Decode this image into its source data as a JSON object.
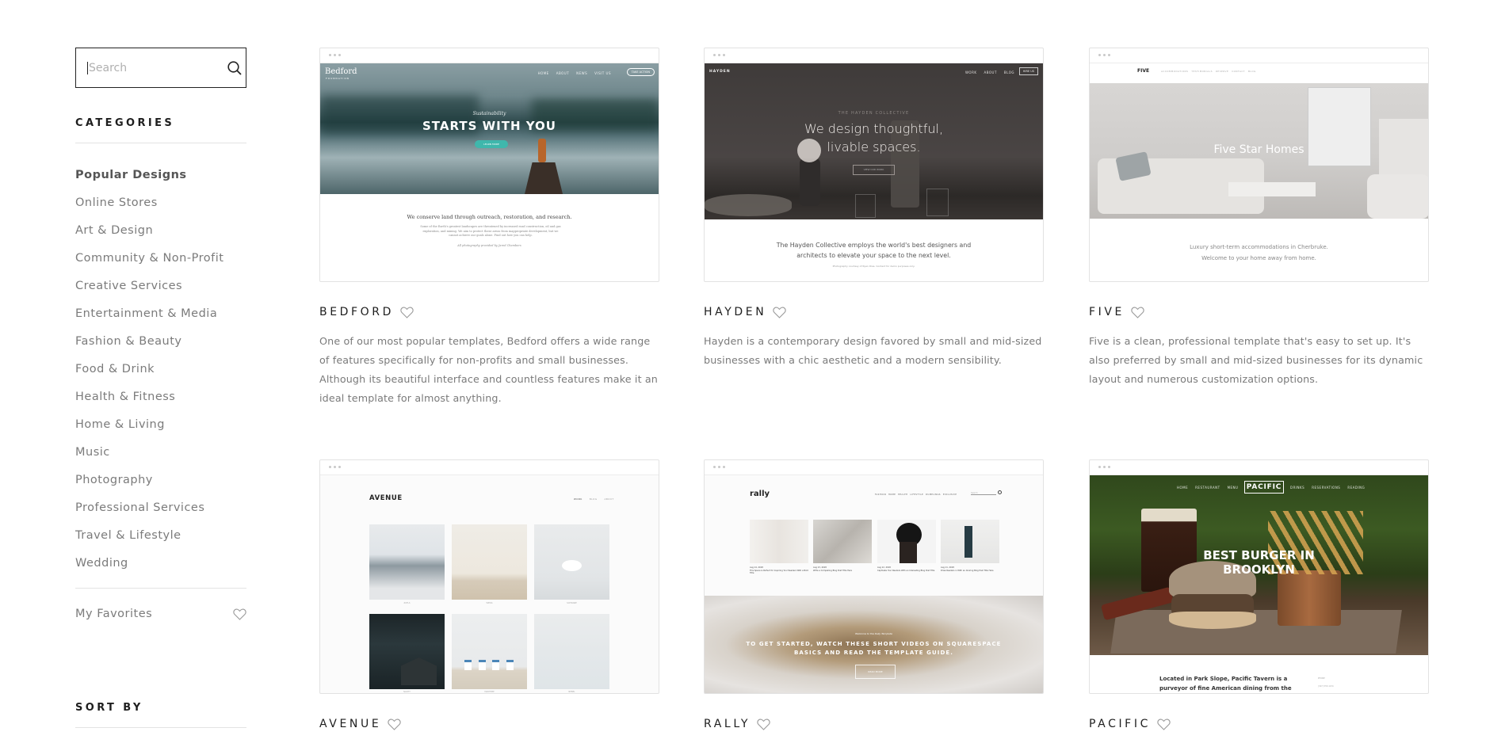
{
  "search": {
    "placeholder": "Search"
  },
  "sidebar": {
    "categories_title": "CATEGORIES",
    "categories": [
      {
        "label": "Popular Designs",
        "active": true
      },
      {
        "label": "Online Stores"
      },
      {
        "label": "Art & Design"
      },
      {
        "label": "Community & Non-Profit"
      },
      {
        "label": "Creative Services"
      },
      {
        "label": "Entertainment & Media"
      },
      {
        "label": "Fashion & Beauty"
      },
      {
        "label": "Food & Drink"
      },
      {
        "label": "Health & Fitness"
      },
      {
        "label": "Home & Living"
      },
      {
        "label": "Music"
      },
      {
        "label": "Photography"
      },
      {
        "label": "Professional Services"
      },
      {
        "label": "Travel & Lifestyle"
      },
      {
        "label": "Wedding"
      }
    ],
    "favorites_label": "My Favorites",
    "sort_title": "SORT BY"
  },
  "templates": [
    {
      "name": "BEDFORD",
      "description": "One of our most popular templates, Bedford offers a wide range of features specifically for non-profits and small businesses. Although its beautiful interface and countless features make it an ideal template for almost anything.",
      "preview": {
        "logo": "Bedford",
        "logo_sub": "FOUNDATION",
        "nav": [
          "HOME",
          "ABOUT",
          "NEWS",
          "VISIT US"
        ],
        "nav_button": "TAKE ACTION",
        "kicker": "Sustainability",
        "headline": "STARTS WITH YOU",
        "cta": "LEARN MORE",
        "body_title": "We conserve land through outreach, restoration, and research.",
        "body_text": "Some of the Earth's greatest landscapes are threatened by increased road construction, oil and gas exploration, and mining. We aim to protect these areas from inappropriate development, but we cannot achieve our goals alone. Find out how you can help.",
        "credit": "All photography provided by Jared Chambers"
      }
    },
    {
      "name": "HAYDEN",
      "description": "Hayden is a contemporary design favored by small and mid-sized businesses with a chic aesthetic and a modern sensibility.",
      "preview": {
        "logo": "HAYDEN",
        "nav": [
          "WORK",
          "ABOUT",
          "BLOG"
        ],
        "nav_button": "HIRE US",
        "kicker": "THE HAYDEN COLLECTIVE",
        "headline_1": "We design thoughtful,",
        "headline_2": "livable spaces.",
        "cta": "VIEW OUR WORK",
        "body_1": "The Hayden Collective employs the world's best designers and",
        "body_2": "architects to elevate your space to the next level.",
        "credit": "Photography courtesy of Ryan Dias. Content for demo purposes only."
      }
    },
    {
      "name": "FIVE",
      "description": "Five is a clean, professional template that's easy to set up. It's also preferred by small and mid-sized businesses for its dynamic layout and numerous customization options.",
      "preview": {
        "logo": "FIVE",
        "nav": [
          "ACCOMMODATIONS",
          "TESTIMONIALS",
          "RESERVE",
          "CONTACT",
          "BLOG"
        ],
        "headline": "Five Star Homes",
        "body_1": "Luxury short-term accommodations in Cherbruke.",
        "body_2": "Welcome to your home away from home."
      }
    },
    {
      "name": "AVENUE",
      "description": "",
      "preview": {
        "logo": "AVENUE",
        "nav": [
          "WORK",
          "BLOG",
          "ABOUT"
        ],
        "captions": [
          "ZUFLS",
          "WEISS",
          "SCHWANE",
          "NACHT",
          "MARITIME",
          "NEBEL"
        ]
      }
    },
    {
      "name": "RALLY",
      "description": "",
      "preview": {
        "logo": "rally",
        "nav": [
          "FASHION",
          "HOME",
          "HEALTH",
          "LIFESTYLE",
          "DUMPLINGS",
          "EXCLUSIVE"
        ],
        "search_placeholder": "Search",
        "posts": [
          {
            "date": "Aug 14, 2018",
            "title": "This Space is Perfect for Inspiring Your Readers With a Bold Title"
          },
          {
            "date": "Aug 13, 2018",
            "title": "Write a Compelling Blog Post Title Here"
          },
          {
            "date": "Aug 12, 2018",
            "title": "Captivate Your Readers With an Interesting Blog Post Title"
          },
          {
            "date": "Aug 11, 2018",
            "title": "Draw Readers in With an Alluring Blog Post Title Here"
          }
        ],
        "kicker": "Welcome to the Rally Template",
        "headline_1": "TO GET STARTED, WATCH THESE SHORT VIDEOS ON SQUARESPACE",
        "headline_2": "BASICS AND READ THE TEMPLATE GUIDE.",
        "cta": "READ MORE"
      }
    },
    {
      "name": "PACIFIC",
      "description": "",
      "preview": {
        "logo": "PACIFIC",
        "nav_left": [
          "HOME",
          "RESTAURANT",
          "MENU"
        ],
        "nav_right": [
          "DRINKS",
          "RESERVATIONS",
          "READING"
        ],
        "headline_1": "BEST BURGER IN",
        "headline_2": "BROOKLYN",
        "body_1": "Located in Park Slope, Pacific Tavern is a",
        "body_2": "purveyor of fine American dining from the",
        "side_label": "PHONE",
        "side_value": "(347) 555-1234"
      }
    }
  ],
  "colors": {
    "accent_teal": "#3fb7ac",
    "text_dark": "#1e1e1e",
    "text_muted": "#7b7b7b",
    "divider": "#e3e3e3"
  }
}
